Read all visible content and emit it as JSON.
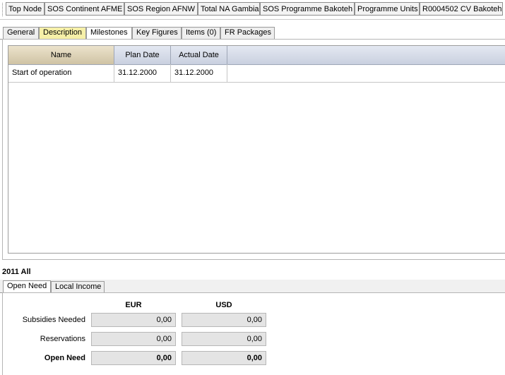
{
  "breadcrumb": [
    "Top Node",
    "SOS Continent AFME",
    "SOS Region AFNW",
    "Total NA Gambia",
    "SOS Programme Bakoteh",
    "Programme Units",
    "R0004502 CV Bakoteh"
  ],
  "tabs": [
    {
      "label": "General"
    },
    {
      "label": "Description"
    },
    {
      "label": "Milestones"
    },
    {
      "label": "Key Figures"
    },
    {
      "label": "Items (0)"
    },
    {
      "label": "FR Packages"
    }
  ],
  "milestones": {
    "columns": [
      "Name",
      "Plan Date",
      "Actual Date"
    ],
    "rows": [
      {
        "name": "Start of operation",
        "plan_date": "31.12.2000",
        "actual_date": "31.12.2000"
      }
    ]
  },
  "period_title": "2011  All",
  "bottom_tabs": [
    {
      "label": "Open Need"
    },
    {
      "label": "Local Income"
    }
  ],
  "figures": {
    "currencies": [
      "EUR",
      "USD"
    ],
    "rows": [
      {
        "label": "Subsidies Needed",
        "eur": "0,00",
        "usd": "0,00"
      },
      {
        "label": "Reservations",
        "eur": "0,00",
        "usd": "0,00"
      },
      {
        "label": "Open Need",
        "eur": "0,00",
        "usd": "0,00"
      }
    ]
  },
  "colors": {
    "highlight_tab": "#f6f0a8",
    "grid_header": "#c9d0df",
    "value_box": "#e4e4e4"
  }
}
